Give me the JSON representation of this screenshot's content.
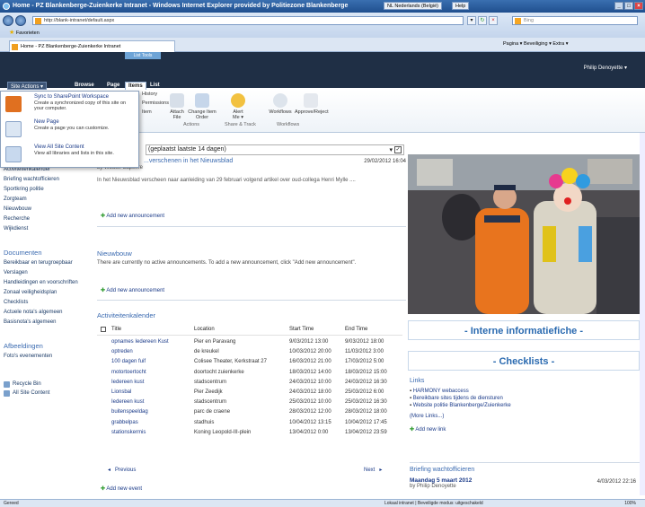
{
  "titlebar": {
    "title": "Home - PZ Blankenberge-Zuienkerke Intranet - Windows Internet Explorer provided by Politiezone Blankenberge",
    "language": "NL Nederlands (België)",
    "help": "Help"
  },
  "browser": {
    "url": "http://blank-intranet/default.aspx",
    "search_placeholder": "Bing",
    "favorites": "Favorieten",
    "tab_title": "Home - PZ Blankenberge-Zuienkerke Intranet",
    "tools": "Pagina ▾  Beveiliging ▾  Extra ▾"
  },
  "ribbon": {
    "list_tools": "List Tools",
    "user": "Philip Denoyette ▾",
    "site_actions": "Site Actions ▾",
    "tabs": [
      "Browse",
      "Page",
      "Items",
      "List"
    ],
    "buttons": [
      {
        "label": "Attach File"
      },
      {
        "label": "Change Item Order"
      },
      {
        "label": "Alert Me ▾"
      },
      {
        "label": "Workflows"
      },
      {
        "label": "Approve/Reject"
      }
    ],
    "groups": [
      "Actions",
      "Share & Track",
      "Workflows"
    ],
    "hidden_labels": [
      "History",
      "Permissions",
      "Item"
    ]
  },
  "site_actions_menu": [
    {
      "title": "Sync to SharePoint Workspace",
      "desc": "Create a synchronized copy of this site on your computer."
    },
    {
      "title": "New Page",
      "desc": "Create a page you can customize."
    },
    {
      "title": "View All Site Content",
      "desc": "View all libraries and lists in this site."
    }
  ],
  "leftnav": {
    "items": [
      "Activiteitenkalender",
      "Briefing wachtofficieren",
      "Sportkring politie",
      "Zorgteam",
      "Nieuwbouw",
      "Recherche",
      "Wijkdienst"
    ],
    "documenten_head": "Documenten",
    "documenten": [
      "Bereikbaar en terugroepbaar",
      "Verslagen",
      "Handleidingen en voorschriften",
      "Zonaal veiligheidsplan",
      "Checklists",
      "Actuele nota's algemeen",
      "Basisnota's algemeen"
    ],
    "afbeeldingen_head": "Afbeeldingen",
    "afbeeldingen": [
      "Foto's evenementen"
    ],
    "recycle": "Recycle Bin",
    "all_content": "All Site Content"
  },
  "announcements": {
    "header": "(geplaatst laatste 14 dagen)",
    "item_title": "...verschenen in het Nieuwsblad",
    "item_author": "by Wouter Lapeirre",
    "item_date": "29/02/2012 16:04",
    "item_body": "In het Nieuwsblad verscheen naar aanleiding van 29 februari volgend artikel over oud-collega Henri Mylle ....",
    "add": "Add new announcement"
  },
  "nieuwbouw": {
    "title": "Nieuwbouw",
    "empty": "There are currently no active announcements. To add a new announcement, click \"Add new announcement\".",
    "add": "Add new announcement"
  },
  "calendar": {
    "title": "Activiteitenkalender",
    "columns": [
      "Title",
      "Location",
      "Start Time",
      "End Time"
    ],
    "rows": [
      [
        "opnames Iedereen Kust",
        "Pier en Paravang",
        "9/03/2012 13:00",
        "9/03/2012 18:00"
      ],
      [
        "optreden",
        "de kreukel",
        "10/03/2012 20:00",
        "11/03/2012 3:00"
      ],
      [
        "100 dagen fuif",
        "Colisee Theater, Kerkstraat 27",
        "16/03/2012 21:00",
        "17/03/2012 5:00"
      ],
      [
        "motortoertocht",
        "doortocht zuienkerke",
        "18/03/2012 14:00",
        "18/03/2012 15:00"
      ],
      [
        "Iedereen kust",
        "stadscentrum",
        "24/03/2012 10:00",
        "24/03/2012 16:30"
      ],
      [
        "Lionsbal",
        "Pier Zeedijk",
        "24/03/2012 18:00",
        "25/03/2012 6:00"
      ],
      [
        "Iedereen kust",
        "stadscentrum",
        "25/03/2012 10:00",
        "25/03/2012 16:30"
      ],
      [
        "buitenspeeldag",
        "parc de craene",
        "28/03/2012 12:00",
        "28/03/2012 18:00"
      ],
      [
        "grabbelpas",
        "stadhuis",
        "10/04/2012 13:15",
        "10/04/2012 17:45"
      ],
      [
        "stationskermis",
        "Koning Leopold-III-plein",
        "13/04/2012 0:00",
        "13/04/2012 23:59"
      ]
    ],
    "prev": "Previous",
    "next": "Next",
    "add": "Add new event"
  },
  "right": {
    "interne": "- Interne informatiefiche -",
    "checklists": "- Checklists -",
    "links_title": "Links",
    "links": [
      "HARMONY webaccess",
      "Bereikbare sites tijdens de diensturen",
      "Website politie Blankenberge/Zuienkerke"
    ],
    "more_links": "(More Links...)",
    "add_link": "Add new link",
    "briefing_title": "Briefing wachtofficieren",
    "briefing_item": "Maandag 5 maart 2012",
    "briefing_author": "by Philip Denoyette",
    "briefing_date": "4/03/2012 22:16"
  },
  "status": {
    "left": "Gereed",
    "mode": "Lokaal intranet | Beveiligde modus: uitgeschakeld",
    "zoom": "100%"
  }
}
